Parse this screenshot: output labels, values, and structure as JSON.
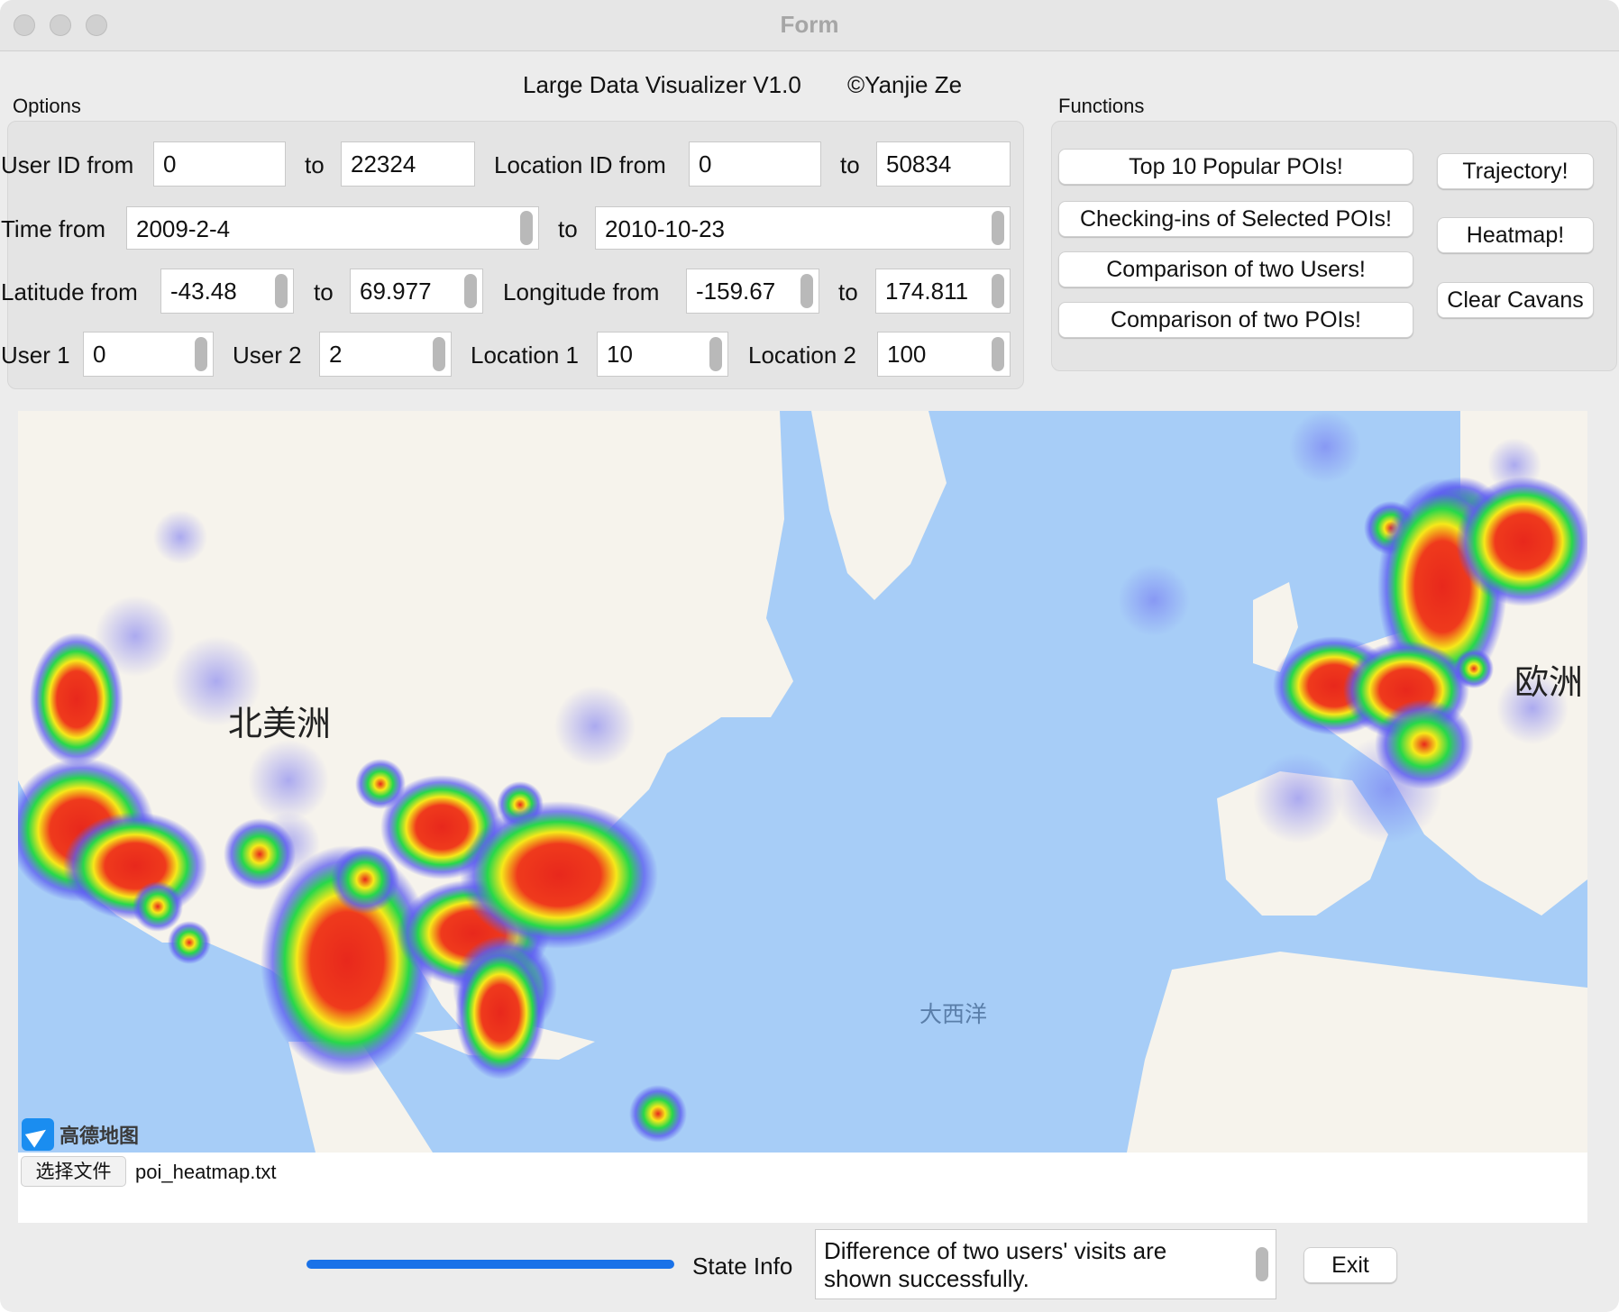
{
  "window": {
    "title": "Form"
  },
  "header": {
    "app_title": "Large Data Visualizer V1.0",
    "copyright": "©Yanjie Ze"
  },
  "options": {
    "group_title": "Options",
    "user_id_from_label": "User ID from",
    "user_id_from": "0",
    "user_id_to_label": "to",
    "user_id_to": "22324",
    "location_id_from_label": "Location ID from",
    "location_id_from": "0",
    "location_id_to_label": "to",
    "location_id_to": "50834",
    "time_from_label": "Time from",
    "time_from": "2009-2-4",
    "time_to_label": "to",
    "time_to": "2010-10-23",
    "latitude_from_label": "Latitude from",
    "latitude_from": "-43.48",
    "latitude_to_label": "to",
    "latitude_to": "69.977",
    "longitude_from_label": "Longitude from",
    "longitude_from": "-159.67",
    "longitude_to_label": "to",
    "longitude_to": "174.811",
    "user1_label": "User 1",
    "user1": "0",
    "user2_label": "User 2",
    "user2": "2",
    "location1_label": "Location 1",
    "location1": "10",
    "location2_label": "Location 2",
    "location2": "100"
  },
  "functions": {
    "group_title": "Functions",
    "top10": "Top 10 Popular POIs!",
    "checkins": "Checking-ins of Selected POIs!",
    "compare_users": "Comparison of two Users!",
    "compare_pois": "Comparison of two POIs!",
    "trajectory": "Trajectory!",
    "heatmap": "Heatmap!",
    "clear": "Clear Cavans"
  },
  "map": {
    "label_north_america": "北美洲",
    "label_europe": "欧洲",
    "label_atlantic": "大西洋",
    "provider": "高德地图",
    "colors": {
      "ocean": "#a7cdf7",
      "land": "#f6f3ec",
      "heat_hot": "#e8281c",
      "heat_mid": "#f6e81a",
      "heat_cool": "#27d84a",
      "heat_edge": "#5b5bf0"
    }
  },
  "file": {
    "button": "选择文件",
    "name": "poi_heatmap.txt"
  },
  "status": {
    "progress_percent": 100,
    "state_info_label": "State Info",
    "state_info_text": "Difference of two users' visits are shown successfully.",
    "exit": "Exit"
  }
}
